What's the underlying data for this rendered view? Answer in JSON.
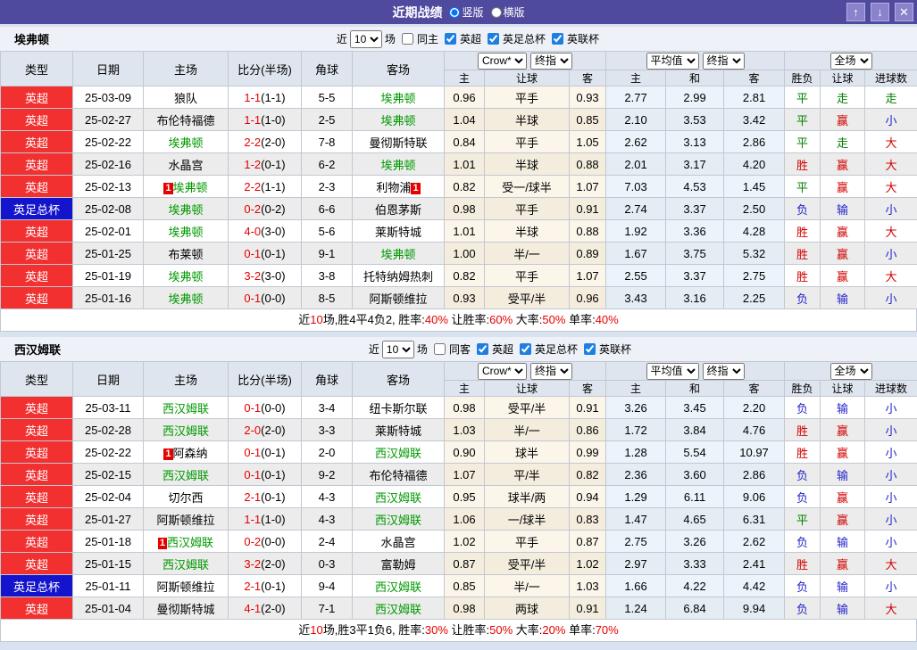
{
  "titlebar": {
    "title": "近期战绩",
    "layout_vertical": "竖版",
    "layout_horizontal": "横版",
    "buttons": {
      "up": "↑",
      "down": "↓",
      "close": "✕"
    }
  },
  "labels": {
    "near": "近",
    "matches": "场"
  },
  "leagues_filter": [
    "英超",
    "英足总杯",
    "英联杯"
  ],
  "dropdowns": {
    "count": "10",
    "odds_source": "Crow*",
    "final_a": "终指",
    "average": "平均值",
    "final_b": "终指",
    "scope": "全场"
  },
  "columns": {
    "type": "类型",
    "date": "日期",
    "home": "主场",
    "score": "比分(半场)",
    "corner": "角球",
    "away": "客场",
    "h": "主",
    "handicap": "让球",
    "a": "客",
    "avg_h": "主",
    "avg_d": "和",
    "avg_a": "客",
    "wdl": "胜负",
    "let_goal": "让球",
    "goals": "进球数"
  },
  "colors": {
    "titlebar_purple": "#4f4a9e",
    "league_red": "#f23030",
    "league_blue": "#1414cc",
    "team_green": "#009900",
    "win_red": "#d20000",
    "draw_green": "#008000",
    "lose_blue": "#2525cc",
    "score_red": "#e60000"
  },
  "tables": [
    {
      "team": "埃弗顿",
      "same_label": "同主",
      "rows": [
        {
          "league": "英超",
          "league_class": "lg-red",
          "date": "25-03-09",
          "home": "狼队",
          "home_class": "",
          "home_card": "",
          "score": "1-1",
          "half": "(1-1)",
          "corner": "5-5",
          "away": "埃弗顿",
          "away_class": "team-hl",
          "away_card": "",
          "h": "0.96",
          "handicap": "平手",
          "a": "0.93",
          "avg_h": "2.77",
          "avg_d": "2.99",
          "avg_a": "2.81",
          "r1": "平",
          "r1c": "c-green",
          "r2": "走",
          "r2c": "c-green",
          "r3": "走",
          "r3c": "c-green"
        },
        {
          "league": "英超",
          "league_class": "lg-red",
          "date": "25-02-27",
          "home": "布伦特福德",
          "home_class": "",
          "home_card": "",
          "score": "1-1",
          "half": "(1-0)",
          "corner": "2-5",
          "away": "埃弗顿",
          "away_class": "team-hl",
          "away_card": "",
          "h": "1.04",
          "handicap": "半球",
          "a": "0.85",
          "avg_h": "2.10",
          "avg_d": "3.53",
          "avg_a": "3.42",
          "r1": "平",
          "r1c": "c-green",
          "r2": "赢",
          "r2c": "c-red",
          "r3": "小",
          "r3c": "c-blue"
        },
        {
          "league": "英超",
          "league_class": "lg-red",
          "date": "25-02-22",
          "home": "埃弗顿",
          "home_class": "team-hl",
          "home_card": "",
          "score": "2-2",
          "half": "(2-0)",
          "corner": "7-8",
          "away": "曼彻斯特联",
          "away_class": "",
          "away_card": "",
          "h": "0.84",
          "handicap": "平手",
          "a": "1.05",
          "avg_h": "2.62",
          "avg_d": "3.13",
          "avg_a": "2.86",
          "r1": "平",
          "r1c": "c-green",
          "r2": "走",
          "r2c": "c-green",
          "r3": "大",
          "r3c": "c-red"
        },
        {
          "league": "英超",
          "league_class": "lg-red",
          "date": "25-02-16",
          "home": "水晶宫",
          "home_class": "",
          "home_card": "",
          "score": "1-2",
          "half": "(0-1)",
          "corner": "6-2",
          "away": "埃弗顿",
          "away_class": "team-hl",
          "away_card": "",
          "h": "1.01",
          "handicap": "半球",
          "a": "0.88",
          "avg_h": "2.01",
          "avg_d": "3.17",
          "avg_a": "4.20",
          "r1": "胜",
          "r1c": "c-red",
          "r2": "赢",
          "r2c": "c-red",
          "r3": "大",
          "r3c": "c-red"
        },
        {
          "league": "英超",
          "league_class": "lg-red",
          "date": "25-02-13",
          "home": "埃弗顿",
          "home_class": "team-hl",
          "home_card": "1",
          "score": "2-2",
          "half": "(1-1)",
          "corner": "2-3",
          "away": "利物浦",
          "away_class": "",
          "away_card": "1",
          "h": "0.82",
          "handicap": "受一/球半",
          "a": "1.07",
          "avg_h": "7.03",
          "avg_d": "4.53",
          "avg_a": "1.45",
          "r1": "平",
          "r1c": "c-green",
          "r2": "赢",
          "r2c": "c-red",
          "r3": "大",
          "r3c": "c-red"
        },
        {
          "league": "英足总杯",
          "league_class": "lg-blue",
          "date": "25-02-08",
          "home": "埃弗顿",
          "home_class": "team-hl",
          "home_card": "",
          "score": "0-2",
          "half": "(0-2)",
          "corner": "6-6",
          "away": "伯恩茅斯",
          "away_class": "",
          "away_card": "",
          "h": "0.98",
          "handicap": "平手",
          "a": "0.91",
          "avg_h": "2.74",
          "avg_d": "3.37",
          "avg_a": "2.50",
          "r1": "负",
          "r1c": "c-blue",
          "r2": "输",
          "r2c": "c-blue",
          "r3": "小",
          "r3c": "c-blue"
        },
        {
          "league": "英超",
          "league_class": "lg-red",
          "date": "25-02-01",
          "home": "埃弗顿",
          "home_class": "team-hl",
          "home_card": "",
          "score": "4-0",
          "half": "(3-0)",
          "corner": "5-6",
          "away": "莱斯特城",
          "away_class": "",
          "away_card": "",
          "h": "1.01",
          "handicap": "半球",
          "a": "0.88",
          "avg_h": "1.92",
          "avg_d": "3.36",
          "avg_a": "4.28",
          "r1": "胜",
          "r1c": "c-red",
          "r2": "赢",
          "r2c": "c-red",
          "r3": "大",
          "r3c": "c-red"
        },
        {
          "league": "英超",
          "league_class": "lg-red",
          "date": "25-01-25",
          "home": "布莱顿",
          "home_class": "",
          "home_card": "",
          "score": "0-1",
          "half": "(0-1)",
          "corner": "9-1",
          "away": "埃弗顿",
          "away_class": "team-hl",
          "away_card": "",
          "h": "1.00",
          "handicap": "半/一",
          "a": "0.89",
          "avg_h": "1.67",
          "avg_d": "3.75",
          "avg_a": "5.32",
          "r1": "胜",
          "r1c": "c-red",
          "r2": "赢",
          "r2c": "c-red",
          "r3": "小",
          "r3c": "c-blue"
        },
        {
          "league": "英超",
          "league_class": "lg-red",
          "date": "25-01-19",
          "home": "埃弗顿",
          "home_class": "team-hl",
          "home_card": "",
          "score": "3-2",
          "half": "(3-0)",
          "corner": "3-8",
          "away": "托特纳姆热刺",
          "away_class": "",
          "away_card": "",
          "h": "0.82",
          "handicap": "平手",
          "a": "1.07",
          "avg_h": "2.55",
          "avg_d": "3.37",
          "avg_a": "2.75",
          "r1": "胜",
          "r1c": "c-red",
          "r2": "赢",
          "r2c": "c-red",
          "r3": "大",
          "r3c": "c-red"
        },
        {
          "league": "英超",
          "league_class": "lg-red",
          "date": "25-01-16",
          "home": "埃弗顿",
          "home_class": "team-hl",
          "home_card": "",
          "score": "0-1",
          "half": "(0-0)",
          "corner": "8-5",
          "away": "阿斯顿维拉",
          "away_class": "",
          "away_card": "",
          "h": "0.93",
          "handicap": "受平/半",
          "a": "0.96",
          "avg_h": "3.43",
          "avg_d": "3.16",
          "avg_a": "2.25",
          "r1": "负",
          "r1c": "c-blue",
          "r2": "输",
          "r2c": "c-blue",
          "r3": "小",
          "r3c": "c-blue"
        }
      ],
      "summary": {
        "pre": "近",
        "count": "10",
        "mid": "场,胜4平4负2, 胜率:",
        "win_rate": "40%",
        "sep1": " 让胜率:",
        "handicap_rate": "60%",
        "sep2": " 大率:",
        "big_rate": "50%",
        "sep3": " 单率:",
        "single_rate": "40%"
      }
    },
    {
      "team": "西汉姆联",
      "same_label": "同客",
      "rows": [
        {
          "league": "英超",
          "league_class": "lg-red",
          "date": "25-03-11",
          "home": "西汉姆联",
          "home_class": "team-hl",
          "home_card": "",
          "score": "0-1",
          "half": "(0-0)",
          "corner": "3-4",
          "away": "纽卡斯尔联",
          "away_class": "",
          "away_card": "",
          "h": "0.98",
          "handicap": "受平/半",
          "a": "0.91",
          "avg_h": "3.26",
          "avg_d": "3.45",
          "avg_a": "2.20",
          "r1": "负",
          "r1c": "c-blue",
          "r2": "输",
          "r2c": "c-blue",
          "r3": "小",
          "r3c": "c-blue"
        },
        {
          "league": "英超",
          "league_class": "lg-red",
          "date": "25-02-28",
          "home": "西汉姆联",
          "home_class": "team-hl",
          "home_card": "",
          "score": "2-0",
          "half": "(2-0)",
          "corner": "3-3",
          "away": "莱斯特城",
          "away_class": "",
          "away_card": "",
          "h": "1.03",
          "handicap": "半/一",
          "a": "0.86",
          "avg_h": "1.72",
          "avg_d": "3.84",
          "avg_a": "4.76",
          "r1": "胜",
          "r1c": "c-red",
          "r2": "赢",
          "r2c": "c-red",
          "r3": "小",
          "r3c": "c-blue"
        },
        {
          "league": "英超",
          "league_class": "lg-red",
          "date": "25-02-22",
          "home": "阿森纳",
          "home_class": "",
          "home_card": "1",
          "score": "0-1",
          "half": "(0-1)",
          "corner": "2-0",
          "away": "西汉姆联",
          "away_class": "team-hl",
          "away_card": "",
          "h": "0.90",
          "handicap": "球半",
          "a": "0.99",
          "avg_h": "1.28",
          "avg_d": "5.54",
          "avg_a": "10.97",
          "r1": "胜",
          "r1c": "c-red",
          "r2": "赢",
          "r2c": "c-red",
          "r3": "小",
          "r3c": "c-blue"
        },
        {
          "league": "英超",
          "league_class": "lg-red",
          "date": "25-02-15",
          "home": "西汉姆联",
          "home_class": "team-hl",
          "home_card": "",
          "score": "0-1",
          "half": "(0-1)",
          "corner": "9-2",
          "away": "布伦特福德",
          "away_class": "",
          "away_card": "",
          "h": "1.07",
          "handicap": "平/半",
          "a": "0.82",
          "avg_h": "2.36",
          "avg_d": "3.60",
          "avg_a": "2.86",
          "r1": "负",
          "r1c": "c-blue",
          "r2": "输",
          "r2c": "c-blue",
          "r3": "小",
          "r3c": "c-blue"
        },
        {
          "league": "英超",
          "league_class": "lg-red",
          "date": "25-02-04",
          "home": "切尔西",
          "home_class": "",
          "home_card": "",
          "score": "2-1",
          "half": "(0-1)",
          "corner": "4-3",
          "away": "西汉姆联",
          "away_class": "team-hl",
          "away_card": "",
          "h": "0.95",
          "handicap": "球半/两",
          "a": "0.94",
          "avg_h": "1.29",
          "avg_d": "6.11",
          "avg_a": "9.06",
          "r1": "负",
          "r1c": "c-blue",
          "r2": "赢",
          "r2c": "c-red",
          "r3": "小",
          "r3c": "c-blue"
        },
        {
          "league": "英超",
          "league_class": "lg-red",
          "date": "25-01-27",
          "home": "阿斯顿维拉",
          "home_class": "",
          "home_card": "",
          "score": "1-1",
          "half": "(1-0)",
          "corner": "4-3",
          "away": "西汉姆联",
          "away_class": "team-hl",
          "away_card": "",
          "h": "1.06",
          "handicap": "一/球半",
          "a": "0.83",
          "avg_h": "1.47",
          "avg_d": "4.65",
          "avg_a": "6.31",
          "r1": "平",
          "r1c": "c-green",
          "r2": "赢",
          "r2c": "c-red",
          "r3": "小",
          "r3c": "c-blue"
        },
        {
          "league": "英超",
          "league_class": "lg-red",
          "date": "25-01-18",
          "home": "西汉姆联",
          "home_class": "team-hl",
          "home_card": "1",
          "score": "0-2",
          "half": "(0-0)",
          "corner": "2-4",
          "away": "水晶宫",
          "away_class": "",
          "away_card": "",
          "h": "1.02",
          "handicap": "平手",
          "a": "0.87",
          "avg_h": "2.75",
          "avg_d": "3.26",
          "avg_a": "2.62",
          "r1": "负",
          "r1c": "c-blue",
          "r2": "输",
          "r2c": "c-blue",
          "r3": "小",
          "r3c": "c-blue"
        },
        {
          "league": "英超",
          "league_class": "lg-red",
          "date": "25-01-15",
          "home": "西汉姆联",
          "home_class": "team-hl",
          "home_card": "",
          "score": "3-2",
          "half": "(2-0)",
          "corner": "0-3",
          "away": "富勒姆",
          "away_class": "",
          "away_card": "",
          "h": "0.87",
          "handicap": "受平/半",
          "a": "1.02",
          "avg_h": "2.97",
          "avg_d": "3.33",
          "avg_a": "2.41",
          "r1": "胜",
          "r1c": "c-red",
          "r2": "赢",
          "r2c": "c-red",
          "r3": "大",
          "r3c": "c-red"
        },
        {
          "league": "英足总杯",
          "league_class": "lg-blue",
          "date": "25-01-11",
          "home": "阿斯顿维拉",
          "home_class": "",
          "home_card": "",
          "score": "2-1",
          "half": "(0-1)",
          "corner": "9-4",
          "away": "西汉姆联",
          "away_class": "team-hl",
          "away_card": "",
          "h": "0.85",
          "handicap": "半/一",
          "a": "1.03",
          "avg_h": "1.66",
          "avg_d": "4.22",
          "avg_a": "4.42",
          "r1": "负",
          "r1c": "c-blue",
          "r2": "输",
          "r2c": "c-blue",
          "r3": "小",
          "r3c": "c-blue"
        },
        {
          "league": "英超",
          "league_class": "lg-red",
          "date": "25-01-04",
          "home": "曼彻斯特城",
          "home_class": "",
          "home_card": "",
          "score": "4-1",
          "half": "(2-0)",
          "corner": "7-1",
          "away": "西汉姆联",
          "away_class": "team-hl",
          "away_card": "",
          "h": "0.98",
          "handicap": "两球",
          "a": "0.91",
          "avg_h": "1.24",
          "avg_d": "6.84",
          "avg_a": "9.94",
          "r1": "负",
          "r1c": "c-blue",
          "r2": "输",
          "r2c": "c-blue",
          "r3": "大",
          "r3c": "c-red"
        }
      ],
      "summary": {
        "pre": "近",
        "count": "10",
        "mid": "场,胜3平1负6, 胜率:",
        "win_rate": "30%",
        "sep1": " 让胜率:",
        "handicap_rate": "50%",
        "sep2": " 大率:",
        "big_rate": "20%",
        "sep3": " 单率:",
        "single_rate": "70%"
      }
    }
  ]
}
